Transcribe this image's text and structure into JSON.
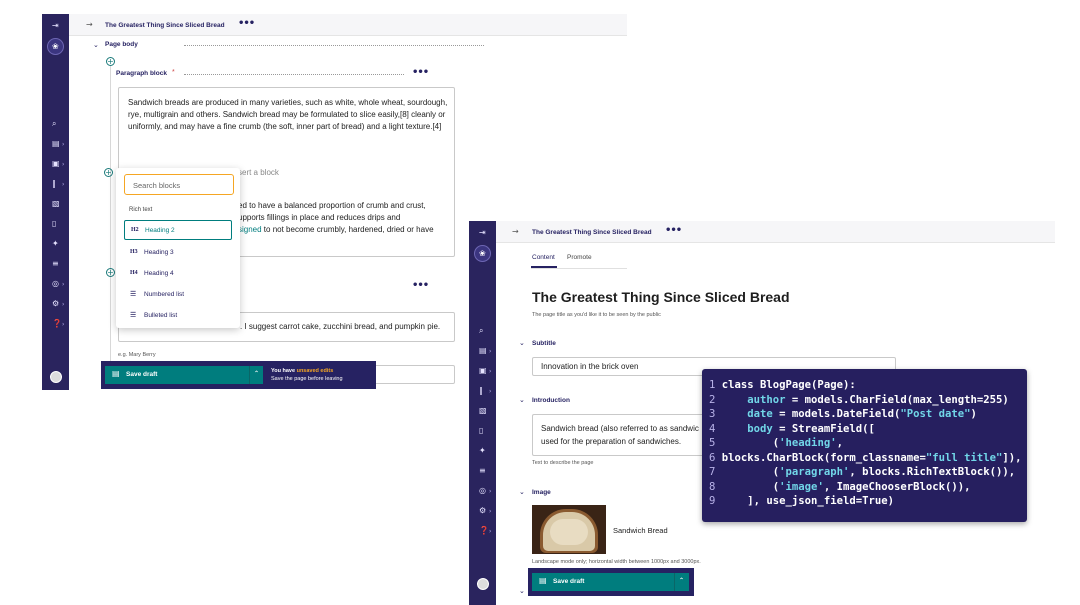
{
  "left_window": {
    "title": "The Greatest Thing Since Sliced Bread",
    "section": "Page body",
    "block_label": "Paragraph block",
    "required_mark": "*",
    "paragraph1": "Sandwich breads are produced in many varieties, such as white, whole wheat, sourdough, rye, multigrain and others. Sandwich bread may be formulated to slice easily,[8] cleanly or uniformly, and may have a fine crumb (the soft, inner part of bread) and a light texture.[4]",
    "insert_hint": "sert a block",
    "paragraph2_line1": "ed to have a balanced proportion of crumb and crust,",
    "paragraph2_line2": "upports fillings in place and reduces drips and",
    "paragraph2_line3_link": "signed",
    "paragraph2_line3_rest": " to not become crumbly, hardened, dried or have",
    "field3_text": ". I suggest carrot cake, zucchini bread, and pumpkin pie.",
    "author_hint": "e.g. Mary Berry",
    "search_placeholder": "Search blocks",
    "menu_group": "Rich text",
    "menu_items": [
      {
        "icon": "H2",
        "label": "Heading 2"
      },
      {
        "icon": "H3",
        "label": "Heading 3"
      },
      {
        "icon": "H4",
        "label": "Heading 4"
      },
      {
        "icon": "☰",
        "label": "Numbered list"
      },
      {
        "icon": "☰",
        "label": "Bulleted list"
      }
    ],
    "save_label": "Save draft",
    "unsaved_prefix": "You have ",
    "unsaved_emph": "unsaved edits",
    "unsaved_sub": "Save the page before leaving"
  },
  "right_window": {
    "title": "The Greatest Thing Since Sliced Bread",
    "tabs": [
      "Content",
      "Promote"
    ],
    "page_title": "The Greatest Thing Since Sliced Bread",
    "page_title_help": "The page title as you'd like it to be seen by the public",
    "subtitle_label": "Subtitle",
    "subtitle_value": "Innovation in the brick oven",
    "intro_label": "Introduction",
    "intro_value_line1": "Sandwich bread (also referred to as sandwic",
    "intro_value_line2": "used for the preparation of sandwiches.",
    "intro_help": "Text to describe the page",
    "image_label": "Image",
    "image_name": "Sandwich Bread",
    "image_help": "Landscape mode only; horizontal width between 1000px and 3000px.",
    "save_label": "Save draft"
  },
  "code": {
    "lines": [
      {
        "n": "1",
        "parts": [
          [
            "",
            "class BlogPage(Page):"
          ]
        ]
      },
      {
        "n": "2",
        "parts": [
          [
            "kw",
            "    author"
          ],
          [
            "",
            " = models.CharField(max_length=255)"
          ]
        ]
      },
      {
        "n": "3",
        "parts": [
          [
            "kw",
            "    date"
          ],
          [
            "",
            " = models.DateField("
          ],
          [
            "str",
            "\"Post date\""
          ],
          [
            "",
            ")"
          ]
        ]
      },
      {
        "n": "4",
        "parts": [
          [
            "kw",
            "    body"
          ],
          [
            "",
            " = StreamField(["
          ]
        ]
      },
      {
        "n": "5",
        "parts": [
          [
            "",
            "        ("
          ],
          [
            "str",
            "'heading'"
          ],
          [
            "",
            ","
          ]
        ]
      },
      {
        "n": "6",
        "parts": [
          [
            "",
            "blocks.CharBlock(form_classname="
          ],
          [
            "str",
            "\"full title\""
          ],
          [
            "",
            "]),"
          ]
        ]
      },
      {
        "n": "7",
        "parts": [
          [
            "",
            "        ("
          ],
          [
            "str",
            "'paragraph'"
          ],
          [
            "",
            ", blocks.RichTextBlock()),"
          ]
        ]
      },
      {
        "n": "8",
        "parts": [
          [
            "",
            "        ("
          ],
          [
            "str",
            "'image'"
          ],
          [
            "",
            ", ImageChooserBlock()),"
          ]
        ]
      },
      {
        "n": "9",
        "parts": [
          [
            "",
            "    ], use_json_field=True)"
          ]
        ]
      }
    ]
  },
  "colors": {
    "sidebar": "#2a245e",
    "accent": "#007d7e",
    "focus": "#f5a623",
    "warning": "#f5a623"
  }
}
